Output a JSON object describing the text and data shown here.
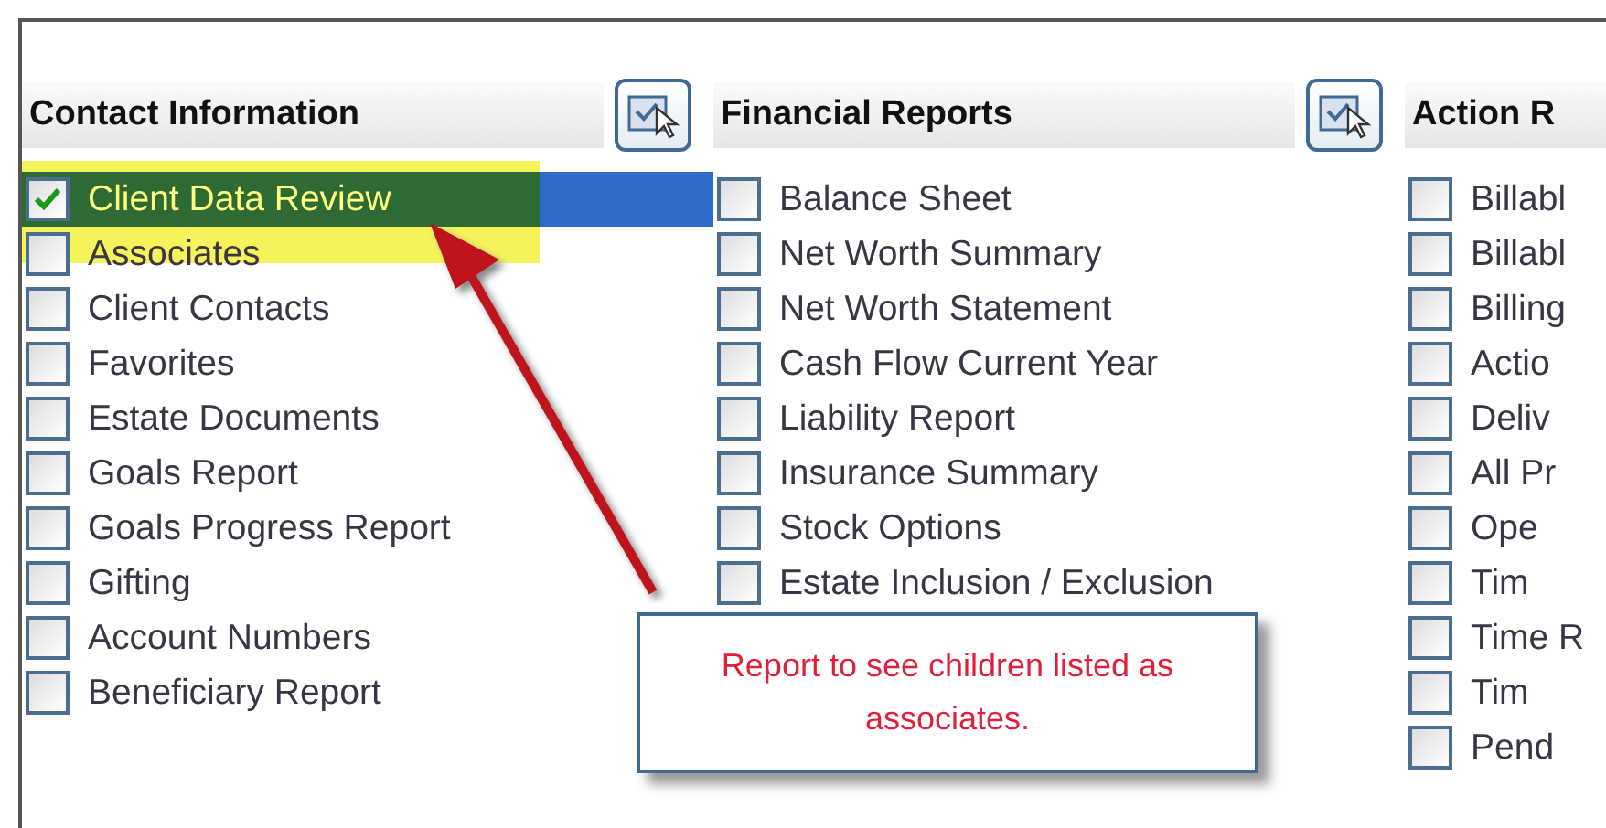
{
  "columns": [
    {
      "title": "Contact Information",
      "select_all_button": true,
      "items": [
        {
          "label": "Client Data Review",
          "checked": true,
          "selected": true
        },
        {
          "label": "Associates",
          "checked": false,
          "selected": false
        },
        {
          "label": "Client Contacts",
          "checked": false,
          "selected": false
        },
        {
          "label": "Favorites",
          "checked": false,
          "selected": false
        },
        {
          "label": "Estate Documents",
          "checked": false,
          "selected": false
        },
        {
          "label": "Goals Report",
          "checked": false,
          "selected": false
        },
        {
          "label": "Goals Progress Report",
          "checked": false,
          "selected": false
        },
        {
          "label": "Gifting",
          "checked": false,
          "selected": false
        },
        {
          "label": "Account Numbers",
          "checked": false,
          "selected": false
        },
        {
          "label": "Beneficiary Report",
          "checked": false,
          "selected": false
        }
      ]
    },
    {
      "title": "Financial Reports",
      "select_all_button": true,
      "items": [
        {
          "label": "Balance Sheet",
          "checked": false,
          "selected": false
        },
        {
          "label": "Net Worth Summary",
          "checked": false,
          "selected": false
        },
        {
          "label": "Net Worth Statement",
          "checked": false,
          "selected": false
        },
        {
          "label": "Cash Flow Current Year",
          "checked": false,
          "selected": false
        },
        {
          "label": "Liability Report",
          "checked": false,
          "selected": false
        },
        {
          "label": "Insurance Summary",
          "checked": false,
          "selected": false
        },
        {
          "label": "Stock Options",
          "checked": false,
          "selected": false
        },
        {
          "label": "Estate Inclusion / Exclusion",
          "checked": false,
          "selected": false
        }
      ]
    },
    {
      "title": "Action R",
      "select_all_button": false,
      "items": [
        {
          "label": "Billabl",
          "checked": false,
          "selected": false
        },
        {
          "label": "Billabl",
          "checked": false,
          "selected": false
        },
        {
          "label": "Billing",
          "checked": false,
          "selected": false
        },
        {
          "label": "Actio",
          "checked": false,
          "selected": false
        },
        {
          "label": "Deliv",
          "checked": false,
          "selected": false
        },
        {
          "label": "All Pr",
          "checked": false,
          "selected": false
        },
        {
          "label": "Ope",
          "checked": false,
          "selected": false
        },
        {
          "label": "Tim",
          "checked": false,
          "selected": false
        },
        {
          "label": "Time R",
          "checked": false,
          "selected": false
        },
        {
          "label": "Tim",
          "checked": false,
          "selected": false
        },
        {
          "label": "Pend",
          "checked": false,
          "selected": false
        }
      ]
    }
  ],
  "annotation": {
    "highlight": true,
    "note": "Report to see children listed as associates."
  }
}
